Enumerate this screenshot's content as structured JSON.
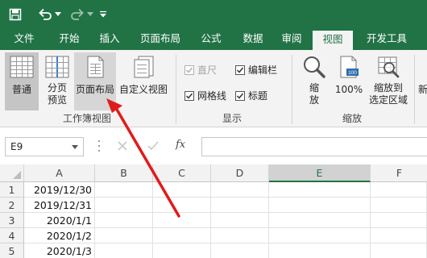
{
  "titlebar": {
    "bg": "#217346"
  },
  "tabs": [
    "文件",
    "开始",
    "插入",
    "页面布局",
    "公式",
    "数据",
    "审阅",
    "视图",
    "开发工具"
  ],
  "ribbon": {
    "workbook_views": {
      "normal": "普通",
      "page_break_1": "分页",
      "page_break_2": "预览",
      "page_layout": "页面布局",
      "custom_views": "自定义视图",
      "group_label": "工作簿视图"
    },
    "show": {
      "ruler": "直尺",
      "formula_bar": "编辑栏",
      "gridlines": "网格线",
      "headings": "标题",
      "group_label": "显示"
    },
    "zoom": {
      "zoom_1": "缩",
      "zoom_2": "放",
      "hundred": "100%",
      "to_sel_1": "缩放到",
      "to_sel_2": "选定区域",
      "group_label": "缩放",
      "next": "新"
    }
  },
  "formula_bar": {
    "name_box": "E9",
    "fx": "fx",
    "value": ""
  },
  "grid": {
    "columns": [
      "A",
      "B",
      "C",
      "D",
      "E",
      "F"
    ],
    "rows": [
      "1",
      "2",
      "3",
      "4",
      "5"
    ],
    "col_a": [
      "2019/12/30",
      "2019/12/31",
      "2020/1/1",
      "2020/1/2",
      "2020/1/3"
    ]
  },
  "colors": {
    "accent": "#217346",
    "arrow": "#e01b1b"
  }
}
